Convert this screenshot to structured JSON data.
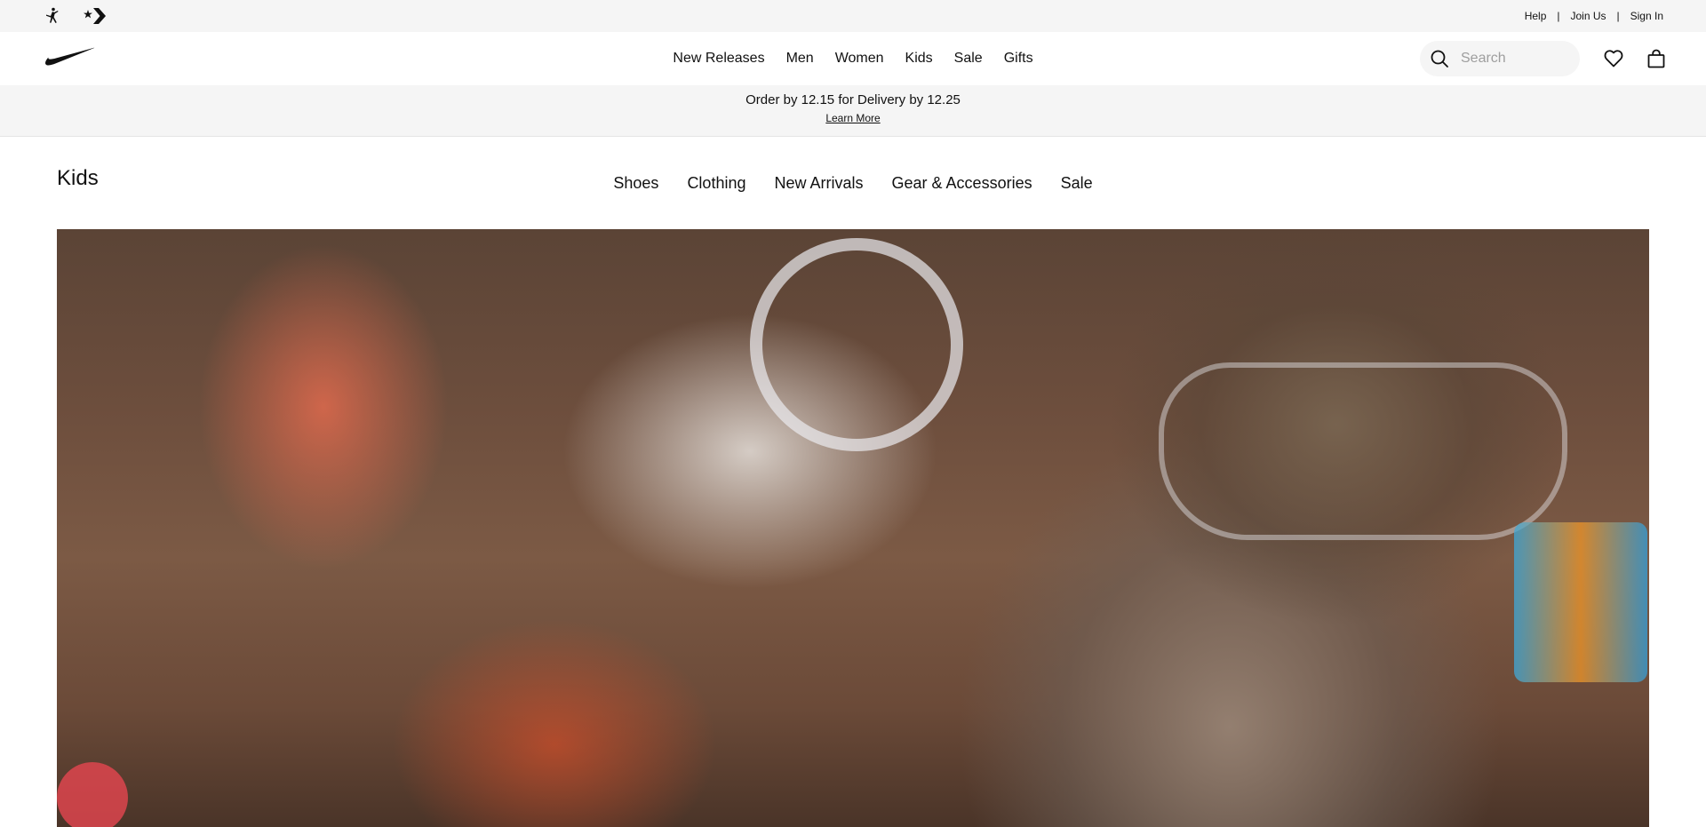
{
  "utility_bar": {
    "brands": [
      {
        "name": "Jordan",
        "icon": "jumpman-icon"
      },
      {
        "name": "Converse",
        "icon": "converse-star-chevron-icon"
      }
    ],
    "links": [
      "Help",
      "Join Us",
      "Sign In"
    ],
    "separator": "|"
  },
  "header": {
    "logo": "nike-swoosh-icon",
    "nav": [
      "New Releases",
      "Men",
      "Women",
      "Kids",
      "Sale",
      "Gifts"
    ],
    "search": {
      "placeholder": "Search",
      "icon": "search-icon"
    },
    "favorites_icon": "heart-icon",
    "bag_icon": "bag-icon"
  },
  "promo": {
    "text": "Order by 12.15 for Delivery by 12.25",
    "link": "Learn More"
  },
  "page": {
    "title": "Kids",
    "subnav": [
      "Shoes",
      "Clothing",
      "New Arrivals",
      "Gear & Accessories",
      "Sale"
    ]
  },
  "colors": {
    "utility_bg": "#f5f5f5",
    "text": "#111111",
    "placeholder": "#9e9e9e"
  }
}
